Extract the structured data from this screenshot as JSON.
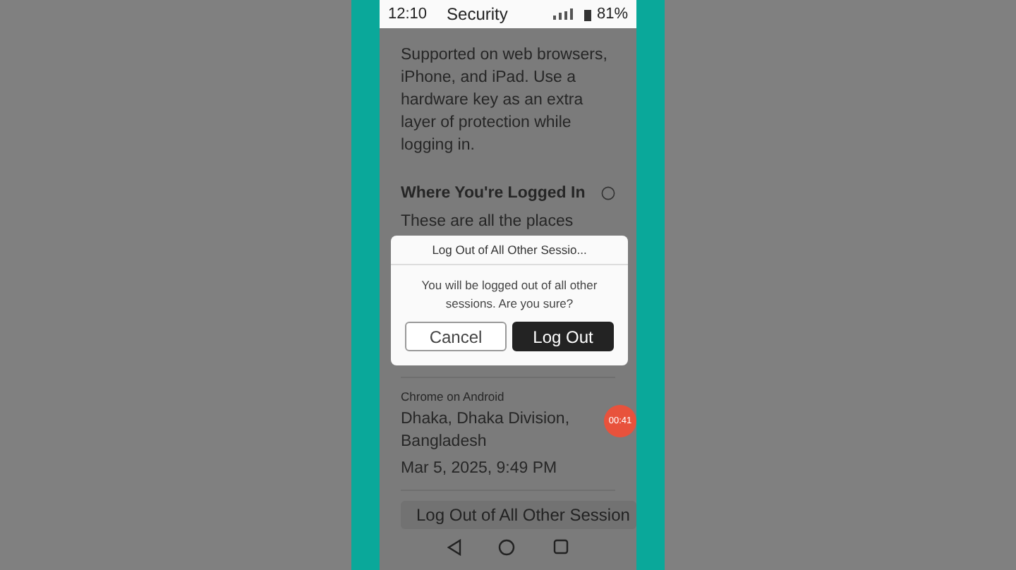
{
  "status_bar": {
    "time": "12:10",
    "title": "Security",
    "battery": "81%"
  },
  "intro": "Supported on web browsers, iPhone, and iPad. Use a hardware key as an extra layer of protection while logging in.",
  "section": {
    "title": "Where You're Logged In",
    "description": "These are all the places"
  },
  "dialog": {
    "title": "Log Out of All Other Sessio...",
    "message": "You will be logged out of all other sessions. Are you sure?",
    "buttons": [
      {
        "label": "Cancel",
        "kind": "secondary"
      },
      {
        "label": "Log Out",
        "kind": "primary"
      }
    ]
  },
  "session": {
    "device": "Chrome on Android",
    "location": "Dhaka, Dhaka Division, Bangladesh",
    "date": "Mar 5, 2025, 9:49 PM"
  },
  "logout_all_button": "Log Out of All Other Session",
  "recording_badge": "00:41"
}
